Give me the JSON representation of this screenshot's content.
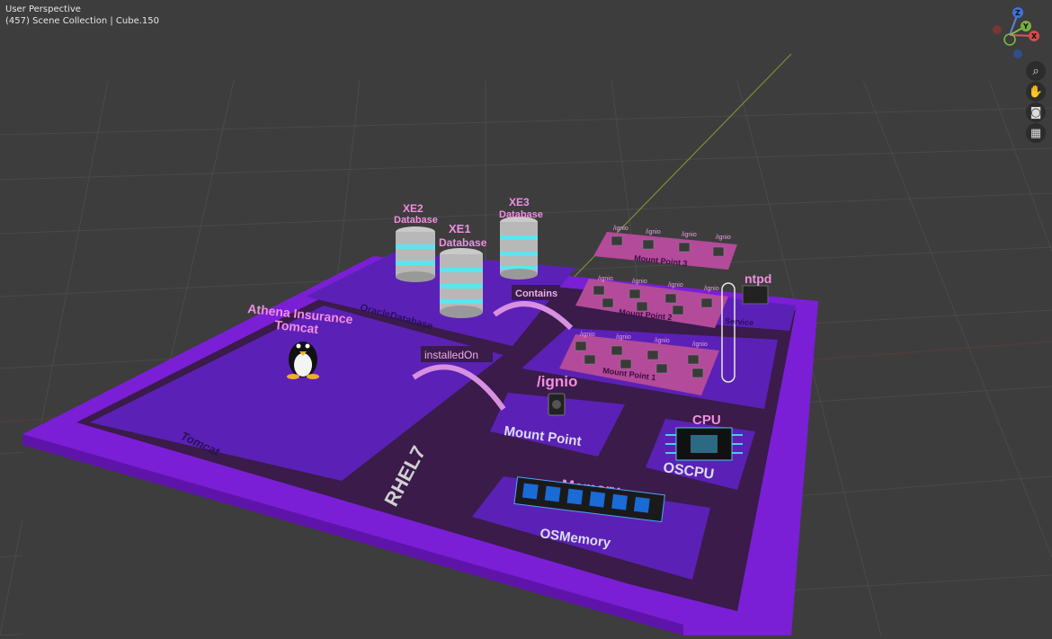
{
  "viewport": {
    "view_name": "User Perspective",
    "collection_info": "(457) Scene Collection | Cube.150"
  },
  "nav_gizmo": {
    "z": "Z",
    "y": "Y",
    "x": "X"
  },
  "colors": {
    "background": "#3d3d3d",
    "grid": "#474747",
    "outer_platform": "#7a1fd6",
    "dark_panel": "#3a1b4a",
    "purple_panel": "#5b21b6",
    "pink_label": "#f28ee0"
  },
  "scene": {
    "databases": [
      {
        "name": "XE2",
        "sub": "Database"
      },
      {
        "name": "XE1",
        "sub": "Database"
      },
      {
        "name": "XE3",
        "sub": "Database"
      }
    ],
    "oracle_panel": "OracleDatabase",
    "contains_label": "Contains",
    "installed_on_label": "installedOn",
    "tomcat_title_1": "Athena Insurance",
    "tomcat_title_2": "Tomcat",
    "tomcat_panel": "Tomcat",
    "os_label": "RHEL7",
    "mount_points": {
      "mp3": "Mount Point 3",
      "mp2": "Mount Point 2",
      "mp1": "Mount Point 1",
      "single": "Mount Point",
      "path": "/ignio"
    },
    "ntpd_label": "ntpd",
    "service_label": "Service",
    "cpu_label": "CPU",
    "oscpu_label": "OSCPU",
    "memory_label": "Memory",
    "osmemory_label": "OSMemory"
  }
}
